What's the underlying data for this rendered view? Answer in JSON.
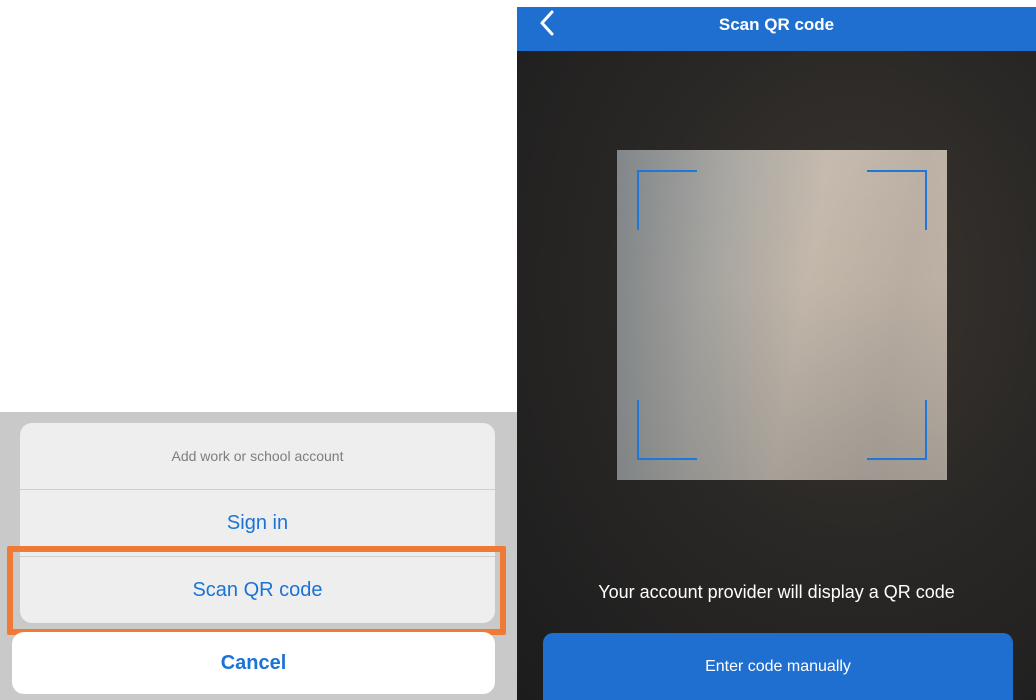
{
  "action_sheet": {
    "title": "Add work or school account",
    "actions": [
      {
        "label": "Sign in"
      },
      {
        "label": "Scan QR code"
      }
    ],
    "cancel_label": "Cancel",
    "highlight_color": "#ef7a36"
  },
  "scanner": {
    "nav_title": "Scan QR code",
    "back_icon": "chevron-left-icon",
    "instruction": "Your account provider will display a QR code",
    "enter_code_label": "Enter code manually",
    "accent_color": "#1f6fd1"
  }
}
